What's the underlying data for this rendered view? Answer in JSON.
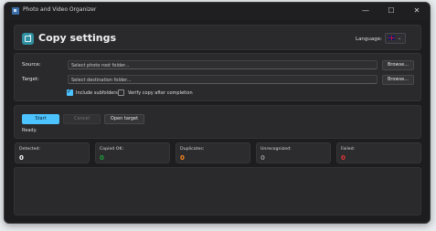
{
  "window": {
    "title": "Photo and Video Organizer",
    "controls": {
      "minimize": "—",
      "maximize": "☐",
      "close": "✕"
    }
  },
  "header": {
    "title": "Copy settings",
    "language_label": "Language:",
    "language_flag": "uk-flag-icon",
    "language_caret": "⌄"
  },
  "settings": {
    "source_label": "Source:",
    "source_placeholder": "Select photo root folder...",
    "target_label": "Target:",
    "target_placeholder": "Select destination folder...",
    "browse_label": "Browse...",
    "include_subfolders_label": "Include subfolders",
    "include_subfolders_checked": true,
    "verify_copy_label": "Verify copy after completion",
    "verify_copy_checked": false
  },
  "actions": {
    "start_label": "Start",
    "cancel_label": "Cancel",
    "open_target_label": "Open target",
    "status_text": "Ready."
  },
  "stats": [
    {
      "label": "Detected:",
      "value": "0",
      "color": "#ffffff"
    },
    {
      "label": "Copied OK:",
      "value": "0",
      "color": "#1e9e3a"
    },
    {
      "label": "Duplicates:",
      "value": "0",
      "color": "#ff8a1e"
    },
    {
      "label": "Unrecognized:",
      "value": "0",
      "color": "#8c8c90"
    },
    {
      "label": "Failed:",
      "value": "0",
      "color": "#e23434"
    }
  ],
  "colors": {
    "accent": "#4cc3ff",
    "logo": "#2f8fa0"
  }
}
